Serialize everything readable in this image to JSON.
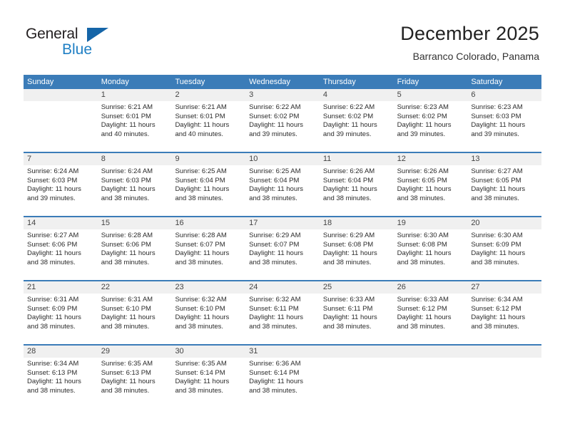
{
  "brand": {
    "name_part1": "General",
    "name_part2": "Blue",
    "triangle_color": "#1565a8",
    "blue_color": "#1f7fc4",
    "dark_color": "#231f20"
  },
  "header": {
    "title": "December 2025",
    "subtitle": "Barranco Colorado, Panama"
  },
  "theme": {
    "header_bar_color": "#3b7cb8",
    "day_band_color": "#f0f0f0",
    "text_color": "#2b2b2b"
  },
  "weekdays": [
    "Sunday",
    "Monday",
    "Tuesday",
    "Wednesday",
    "Thursday",
    "Friday",
    "Saturday"
  ],
  "weeks": [
    {
      "days": [
        {
          "number": "",
          "lines": []
        },
        {
          "number": "1",
          "lines": [
            "Sunrise: 6:21 AM",
            "Sunset: 6:01 PM",
            "Daylight: 11 hours",
            "and 40 minutes."
          ]
        },
        {
          "number": "2",
          "lines": [
            "Sunrise: 6:21 AM",
            "Sunset: 6:01 PM",
            "Daylight: 11 hours",
            "and 40 minutes."
          ]
        },
        {
          "number": "3",
          "lines": [
            "Sunrise: 6:22 AM",
            "Sunset: 6:02 PM",
            "Daylight: 11 hours",
            "and 39 minutes."
          ]
        },
        {
          "number": "4",
          "lines": [
            "Sunrise: 6:22 AM",
            "Sunset: 6:02 PM",
            "Daylight: 11 hours",
            "and 39 minutes."
          ]
        },
        {
          "number": "5",
          "lines": [
            "Sunrise: 6:23 AM",
            "Sunset: 6:02 PM",
            "Daylight: 11 hours",
            "and 39 minutes."
          ]
        },
        {
          "number": "6",
          "lines": [
            "Sunrise: 6:23 AM",
            "Sunset: 6:03 PM",
            "Daylight: 11 hours",
            "and 39 minutes."
          ]
        }
      ]
    },
    {
      "days": [
        {
          "number": "7",
          "lines": [
            "Sunrise: 6:24 AM",
            "Sunset: 6:03 PM",
            "Daylight: 11 hours",
            "and 39 minutes."
          ]
        },
        {
          "number": "8",
          "lines": [
            "Sunrise: 6:24 AM",
            "Sunset: 6:03 PM",
            "Daylight: 11 hours",
            "and 38 minutes."
          ]
        },
        {
          "number": "9",
          "lines": [
            "Sunrise: 6:25 AM",
            "Sunset: 6:04 PM",
            "Daylight: 11 hours",
            "and 38 minutes."
          ]
        },
        {
          "number": "10",
          "lines": [
            "Sunrise: 6:25 AM",
            "Sunset: 6:04 PM",
            "Daylight: 11 hours",
            "and 38 minutes."
          ]
        },
        {
          "number": "11",
          "lines": [
            "Sunrise: 6:26 AM",
            "Sunset: 6:04 PM",
            "Daylight: 11 hours",
            "and 38 minutes."
          ]
        },
        {
          "number": "12",
          "lines": [
            "Sunrise: 6:26 AM",
            "Sunset: 6:05 PM",
            "Daylight: 11 hours",
            "and 38 minutes."
          ]
        },
        {
          "number": "13",
          "lines": [
            "Sunrise: 6:27 AM",
            "Sunset: 6:05 PM",
            "Daylight: 11 hours",
            "and 38 minutes."
          ]
        }
      ]
    },
    {
      "days": [
        {
          "number": "14",
          "lines": [
            "Sunrise: 6:27 AM",
            "Sunset: 6:06 PM",
            "Daylight: 11 hours",
            "and 38 minutes."
          ]
        },
        {
          "number": "15",
          "lines": [
            "Sunrise: 6:28 AM",
            "Sunset: 6:06 PM",
            "Daylight: 11 hours",
            "and 38 minutes."
          ]
        },
        {
          "number": "16",
          "lines": [
            "Sunrise: 6:28 AM",
            "Sunset: 6:07 PM",
            "Daylight: 11 hours",
            "and 38 minutes."
          ]
        },
        {
          "number": "17",
          "lines": [
            "Sunrise: 6:29 AM",
            "Sunset: 6:07 PM",
            "Daylight: 11 hours",
            "and 38 minutes."
          ]
        },
        {
          "number": "18",
          "lines": [
            "Sunrise: 6:29 AM",
            "Sunset: 6:08 PM",
            "Daylight: 11 hours",
            "and 38 minutes."
          ]
        },
        {
          "number": "19",
          "lines": [
            "Sunrise: 6:30 AM",
            "Sunset: 6:08 PM",
            "Daylight: 11 hours",
            "and 38 minutes."
          ]
        },
        {
          "number": "20",
          "lines": [
            "Sunrise: 6:30 AM",
            "Sunset: 6:09 PM",
            "Daylight: 11 hours",
            "and 38 minutes."
          ]
        }
      ]
    },
    {
      "days": [
        {
          "number": "21",
          "lines": [
            "Sunrise: 6:31 AM",
            "Sunset: 6:09 PM",
            "Daylight: 11 hours",
            "and 38 minutes."
          ]
        },
        {
          "number": "22",
          "lines": [
            "Sunrise: 6:31 AM",
            "Sunset: 6:10 PM",
            "Daylight: 11 hours",
            "and 38 minutes."
          ]
        },
        {
          "number": "23",
          "lines": [
            "Sunrise: 6:32 AM",
            "Sunset: 6:10 PM",
            "Daylight: 11 hours",
            "and 38 minutes."
          ]
        },
        {
          "number": "24",
          "lines": [
            "Sunrise: 6:32 AM",
            "Sunset: 6:11 PM",
            "Daylight: 11 hours",
            "and 38 minutes."
          ]
        },
        {
          "number": "25",
          "lines": [
            "Sunrise: 6:33 AM",
            "Sunset: 6:11 PM",
            "Daylight: 11 hours",
            "and 38 minutes."
          ]
        },
        {
          "number": "26",
          "lines": [
            "Sunrise: 6:33 AM",
            "Sunset: 6:12 PM",
            "Daylight: 11 hours",
            "and 38 minutes."
          ]
        },
        {
          "number": "27",
          "lines": [
            "Sunrise: 6:34 AM",
            "Sunset: 6:12 PM",
            "Daylight: 11 hours",
            "and 38 minutes."
          ]
        }
      ]
    },
    {
      "days": [
        {
          "number": "28",
          "lines": [
            "Sunrise: 6:34 AM",
            "Sunset: 6:13 PM",
            "Daylight: 11 hours",
            "and 38 minutes."
          ]
        },
        {
          "number": "29",
          "lines": [
            "Sunrise: 6:35 AM",
            "Sunset: 6:13 PM",
            "Daylight: 11 hours",
            "and 38 minutes."
          ]
        },
        {
          "number": "30",
          "lines": [
            "Sunrise: 6:35 AM",
            "Sunset: 6:14 PM",
            "Daylight: 11 hours",
            "and 38 minutes."
          ]
        },
        {
          "number": "31",
          "lines": [
            "Sunrise: 6:36 AM",
            "Sunset: 6:14 PM",
            "Daylight: 11 hours",
            "and 38 minutes."
          ]
        },
        {
          "number": "",
          "lines": []
        },
        {
          "number": "",
          "lines": []
        },
        {
          "number": "",
          "lines": []
        }
      ]
    }
  ]
}
